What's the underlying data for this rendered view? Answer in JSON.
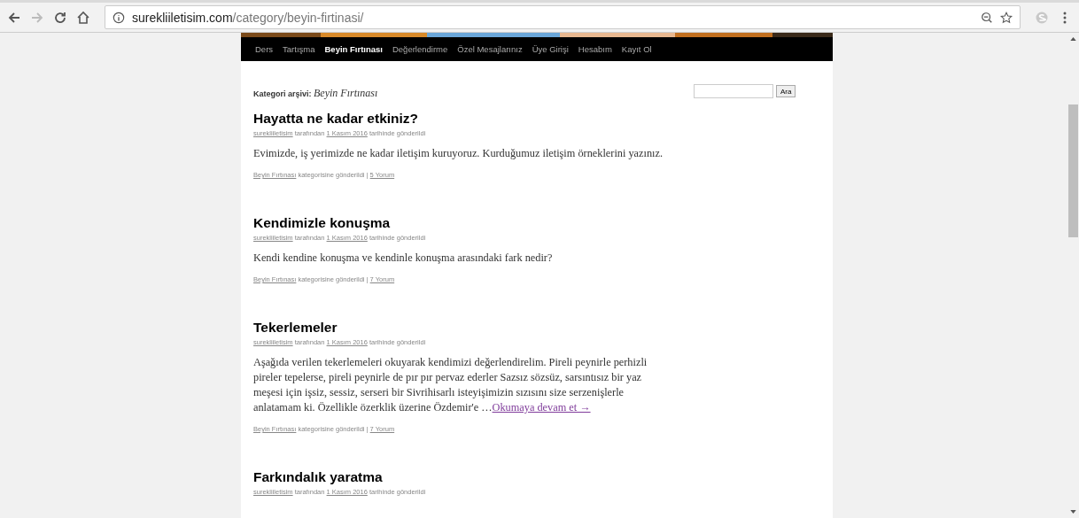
{
  "browser": {
    "url_host": "surekliiletisim.com",
    "url_path": "/category/beyin-firtinasi/"
  },
  "nav": [
    {
      "label": "Ders",
      "selected": false
    },
    {
      "label": "Tartışma",
      "selected": false
    },
    {
      "label": "Beyin Fırtınası",
      "selected": true
    },
    {
      "label": "Değerlendirme",
      "selected": false
    },
    {
      "label": "Özel Mesajlarınız",
      "selected": false
    },
    {
      "label": "Üye Girişi",
      "selected": false
    },
    {
      "label": "Hesabım",
      "selected": false
    },
    {
      "label": "Kayıt Ol",
      "selected": false
    }
  ],
  "archive": {
    "label": "Kategori arşivi:",
    "category": "Beyin Fırtınası"
  },
  "search": {
    "button": "Ara"
  },
  "posts": [
    {
      "title": "Hayatta ne kadar etkiniz?",
      "author": "surekliiletisim",
      "by": "tarafından",
      "date": "1 Kasım 2016",
      "posted": "tarihinde gönderildi",
      "body": "Evimizde, iş yerimizde ne kadar iletişim kuruyoruz. Kurduğumuz iletişim örneklerini yazınız.",
      "category": "Beyin Fırtınası",
      "category_text": "kategorisine gönderildi |",
      "comments": "5 Yorum"
    },
    {
      "title": "Kendimizle konuşma",
      "author": "surekliiletisim",
      "by": "tarafından",
      "date": "1 Kasım 2016",
      "posted": "tarihinde gönderildi",
      "body": "Kendi kendine konuşma ve kendinle konuşma arasındaki fark nedir?",
      "category": "Beyin Fırtınası",
      "category_text": "kategorisine gönderildi |",
      "comments": "7 Yorum"
    },
    {
      "title": "Tekerlemeler",
      "author": "surekliiletisim",
      "by": "tarafından",
      "date": "1 Kasım 2016",
      "posted": "tarihinde gönderildi",
      "body": "Aşağıda verilen tekerlemeleri okuyarak kendimizi değerlendirelim. Pireli peynirle perhizli pireler tepelerse, pireli peynirle de pır pır pervaz ederler Sazsız sözsüz, sarsıntısız bir yaz meşesi için işsiz, sessiz, serseri bir Sivrihisarlı isteyişimizin sızısını size serzenişlerle anlatamam ki. Özellikle özerklik üzerine Özdemir'e …",
      "more": "Okumaya devam et →",
      "category": "Beyin Fırtınası",
      "category_text": "kategorisine gönderildi |",
      "comments": "7 Yorum"
    },
    {
      "title": "Farkındalık yaratma",
      "author": "surekliiletisim",
      "by": "tarafından",
      "date": "1 Kasım 2016",
      "posted": "tarihinde gönderildi"
    }
  ]
}
